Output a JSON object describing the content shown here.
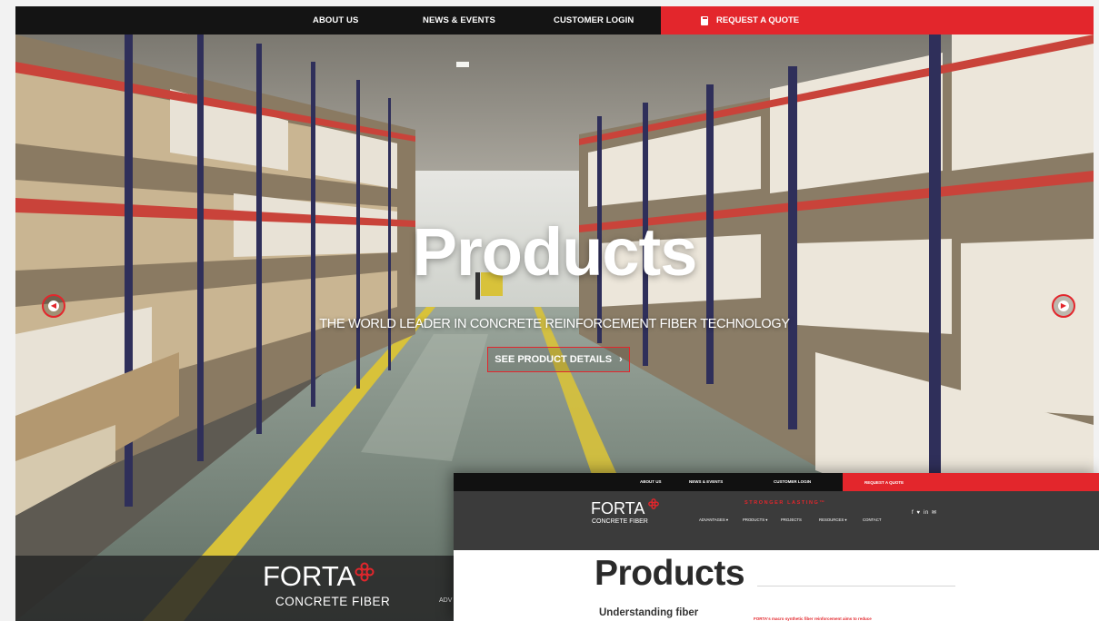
{
  "main_screenshot": {
    "topbar": {
      "nav": [
        "ABOUT US",
        "NEWS & EVENTS",
        "CUSTOMER LOGIN"
      ],
      "quote_label": "REQUEST A QUOTE",
      "quote_icon": "calculator-icon"
    },
    "hero": {
      "title": "Products",
      "subtitle": "THE WORLD LEADER IN CONCRETE REINFORCEMENT FIBER TECHNOLOGY",
      "cta_label": "SEE PRODUCT DETAILS",
      "cta_arrow": "›",
      "prev_icon": "chevron-left-icon",
      "next_icon": "chevron-right-icon"
    },
    "logo": {
      "word": "FORTA",
      "tagline": "CONCRETE FIBER"
    },
    "menu_cut": "ADV"
  },
  "inset_screenshot": {
    "topbar": {
      "nav": [
        "ABOUT US",
        "NEWS & EVENTS",
        "CUSTOMER LOGIN"
      ],
      "quote_label": "REQUEST A QUOTE"
    },
    "logo": {
      "word": "FORTA",
      "tagline": "CONCRETE FIBER"
    },
    "slogan": "STRONGER LASTING™",
    "menu": [
      "ADVANTAGES ▾",
      "PRODUCTS ▾",
      "PROJECTS",
      "RESOURCES ▾",
      "CONTACT"
    ],
    "social": "f ♥ in ✉",
    "page_title": "Products",
    "subheading": "Understanding fiber",
    "intro_text": "FORTA's macro synthetic fiber reinforcement aims to reduce"
  },
  "colors": {
    "brand_red": "#e3262c",
    "topbar_black": "#141414",
    "header_grey": "#3b3b3b"
  }
}
